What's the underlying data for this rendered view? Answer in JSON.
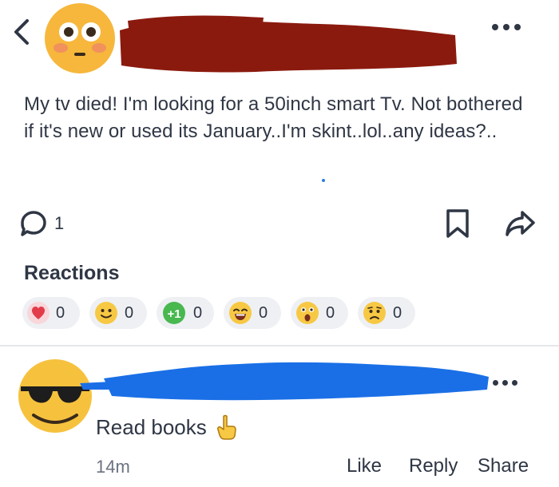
{
  "post": {
    "text": "My tv died!  I'm looking for a 50inch smart Tv.  Not bothered if it's new or used  its January..I'm skint..lol..any ideas?..",
    "comment_count": "1"
  },
  "reactions": {
    "title": "Reactions",
    "items": [
      {
        "icon": "heart-icon",
        "count": "0"
      },
      {
        "icon": "smile-icon",
        "count": "0"
      },
      {
        "icon": "plus-one-icon",
        "label": "+1",
        "count": "0"
      },
      {
        "icon": "laugh-icon",
        "count": "0"
      },
      {
        "icon": "wow-icon",
        "count": "0"
      },
      {
        "icon": "sad-icon",
        "count": "0"
      }
    ]
  },
  "comment": {
    "text": "Read books",
    "time": "14m",
    "like_label": "Like",
    "reply_label": "Reply",
    "share_label": "Share"
  },
  "colors": {
    "text": "#2f3644",
    "redaction_red": "#8b1a0e",
    "redaction_blue": "#1a6fe6",
    "reaction_bg": "#eef0f3"
  }
}
